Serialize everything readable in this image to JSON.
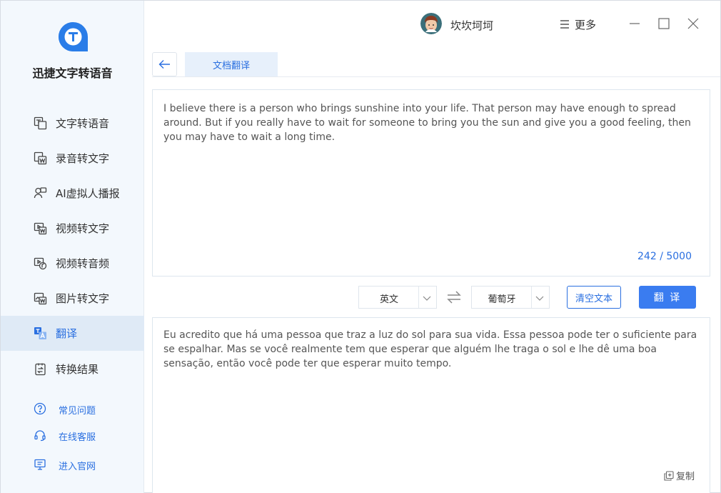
{
  "app": {
    "name": "迅捷文字转语音"
  },
  "sidebar": {
    "items": [
      {
        "label": "文字转语音",
        "icon": "text-to-speech-icon"
      },
      {
        "label": "录音转文字",
        "icon": "audio-to-text-icon"
      },
      {
        "label": "AI虚拟人播报",
        "icon": "ai-avatar-icon"
      },
      {
        "label": "视频转文字",
        "icon": "video-to-text-icon"
      },
      {
        "label": "视频转音频",
        "icon": "video-to-audio-icon"
      },
      {
        "label": "图片转文字",
        "icon": "image-to-text-icon"
      },
      {
        "label": "翻译",
        "icon": "translate-icon",
        "active": true
      },
      {
        "label": "转换结果",
        "icon": "results-icon"
      }
    ],
    "help": [
      {
        "label": "常见问题",
        "icon": "question-icon"
      },
      {
        "label": "在线客服",
        "icon": "headset-icon"
      },
      {
        "label": "进入官网",
        "icon": "monitor-icon"
      }
    ]
  },
  "titlebar": {
    "username": "坎坎坷坷",
    "more_label": "更多"
  },
  "tabs": {
    "active_label": "文档翻译"
  },
  "source": {
    "text": "I believe there is a person who brings sunshine into your life. That person may have enough to spread around. But if you really have to wait for someone to bring you the sun and give you a good feeling, then you may have to wait a long time.",
    "char_count": "242 / 5000"
  },
  "controls": {
    "source_lang": "英文",
    "target_lang": "葡萄牙",
    "clear_label": "清空文本",
    "translate_label": "翻 译"
  },
  "result": {
    "text": "Eu acredito que há uma pessoa que traz a luz do sol para sua vida. Essa pessoa pode ter o suficiente para se espalhar. Mas se você realmente tem que esperar que alguém lhe traga o sol e lhe dê uma boa sensação, então você pode ter que esperar muito tempo.",
    "copy_label": "复制"
  },
  "colors": {
    "accent": "#2a6fe0",
    "button": "#3a7cf0",
    "sidebar_bg": "#f3f8fd",
    "active_bg": "#dfeaf6"
  }
}
